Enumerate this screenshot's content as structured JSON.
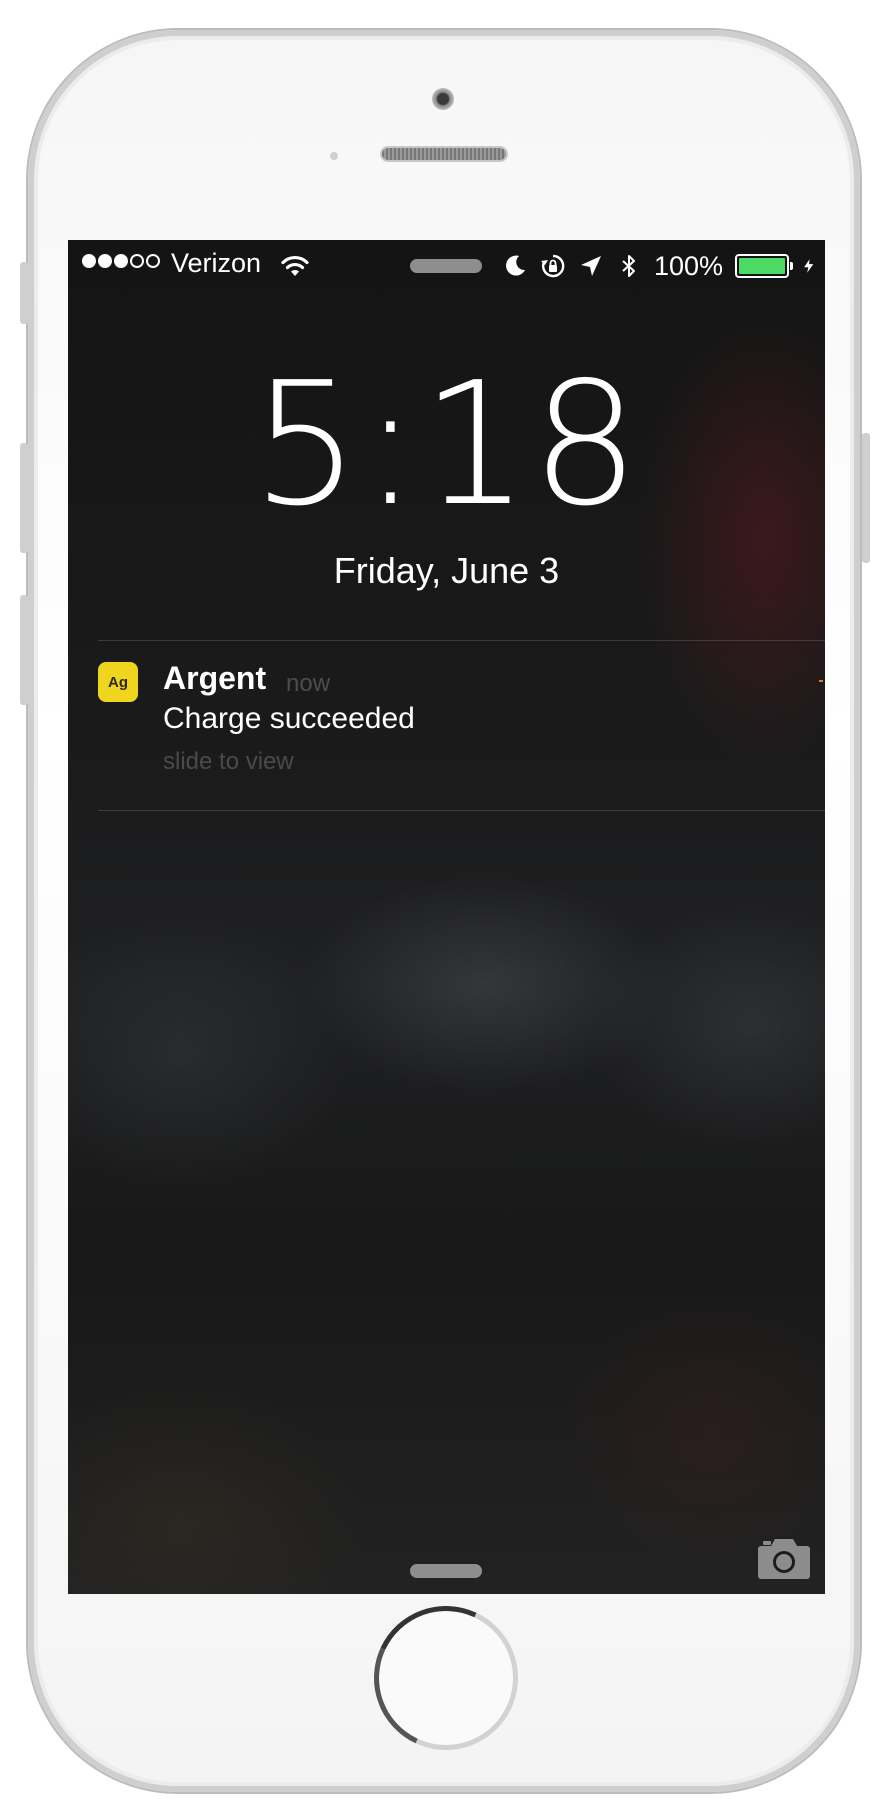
{
  "status_bar": {
    "signal_strength": 3,
    "signal_max": 5,
    "carrier": "Verizon",
    "icons": [
      "wifi-icon",
      "moon-icon",
      "rotation-lock-icon",
      "location-arrow-icon",
      "bluetooth-icon",
      "charging-bolt-icon"
    ],
    "battery_percent": "100%",
    "battery_level": 1.0,
    "battery_color": "#4cd964"
  },
  "lock_screen": {
    "time": "5:18",
    "date": "Friday, June 3"
  },
  "notification": {
    "app_icon_text": "Ag",
    "app_icon_color": "#f0d51f",
    "app_name": "Argent",
    "time": "now",
    "message": "Charge succeeded",
    "hint": "slide to view"
  },
  "footer": {
    "camera_icon": "camera-icon"
  }
}
